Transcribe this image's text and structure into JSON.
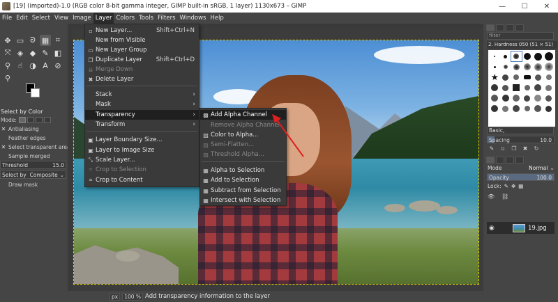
{
  "window": {
    "title": "[19] (imported)-1.0 (RGB color 8-bit gamma integer, GIMP built-in sRGB, 1 layer) 1130x673 – GIMP",
    "minimize": "—",
    "maximize": "☐",
    "close": "✕"
  },
  "menubar": [
    "File",
    "Edit",
    "Select",
    "View",
    "Image",
    "Layer",
    "Colors",
    "Tools",
    "Filters",
    "Windows",
    "Help"
  ],
  "layer_menu": {
    "new_layer": "New Layer...",
    "new_layer_key": "Shift+Ctrl+N",
    "new_from_visible": "New from Visible",
    "new_layer_group": "New Layer Group",
    "duplicate_layer": "Duplicate Layer",
    "duplicate_layer_key": "Shift+Ctrl+D",
    "merge_down": "Merge Down",
    "delete_layer": "Delete Layer",
    "stack": "Stack",
    "mask": "Mask",
    "transparency": "Transparency",
    "transform": "Transform",
    "layer_boundary_size": "Layer Boundary Size...",
    "layer_to_image_size": "Layer to Image Size",
    "scale_layer": "Scale Layer...",
    "crop_to_selection": "Crop to Selection",
    "crop_to_content": "Crop to Content"
  },
  "transparency_menu": {
    "add_alpha_channel": "Add Alpha Channel",
    "remove_alpha_channel": "Remove Alpha Channel",
    "color_to_alpha": "Color to Alpha...",
    "semi_flatten": "Semi-Flatten...",
    "threshold_alpha": "Threshold Alpha...",
    "alpha_to_selection": "Alpha to Selection",
    "add_to_selection": "Add to Selection",
    "subtract_from_selection": "Subtract from Selection",
    "intersect_with_selection": "Intersect with Selection"
  },
  "tool_options": {
    "title": "Select by Color",
    "mode_label": "Mode:",
    "antialiasing": "Antialiasing",
    "feather_edges": "Feather edges",
    "select_transparent": "Select transparent areas",
    "sample_merged": "Sample merged",
    "threshold_label": "Threshold",
    "threshold_value": "15.0",
    "select_by_label": "Select by",
    "select_by_value": "Composite",
    "draw_mask": "Draw mask"
  },
  "brushes": {
    "filter_placeholder": "filter",
    "current_brush": "2. Hardness 050 (51 × 51)",
    "brush_set": "Basic,",
    "spacing_label": "Spacing",
    "spacing_value": "10.0"
  },
  "layers_panel": {
    "mode_label": "Mode",
    "mode_value": "Normal",
    "opacity_label": "Opacity",
    "opacity_value": "100.0",
    "opacity_fraction": 1.0,
    "lock_label": "Lock:",
    "layer_name": "19.jpg"
  },
  "status": {
    "unit": "px",
    "zoom": "100 %",
    "message": "Add transparency information to the layer"
  }
}
